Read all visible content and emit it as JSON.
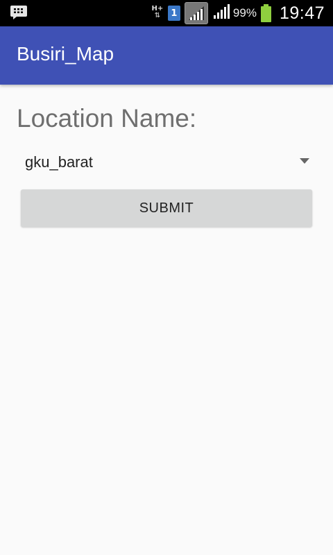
{
  "status_bar": {
    "left_icon": "bbm-chat-icon",
    "network_type": "H+",
    "sim_slot": "1",
    "battery_percent": "99%",
    "time": "19:47",
    "battery_color": "#8fcf3f"
  },
  "app_bar": {
    "title": "Busiri_Map",
    "color": "#3f51b5"
  },
  "form": {
    "location_label": "Location Name:",
    "location_selected": "gku_barat",
    "submit_label": "SUBMIT"
  }
}
